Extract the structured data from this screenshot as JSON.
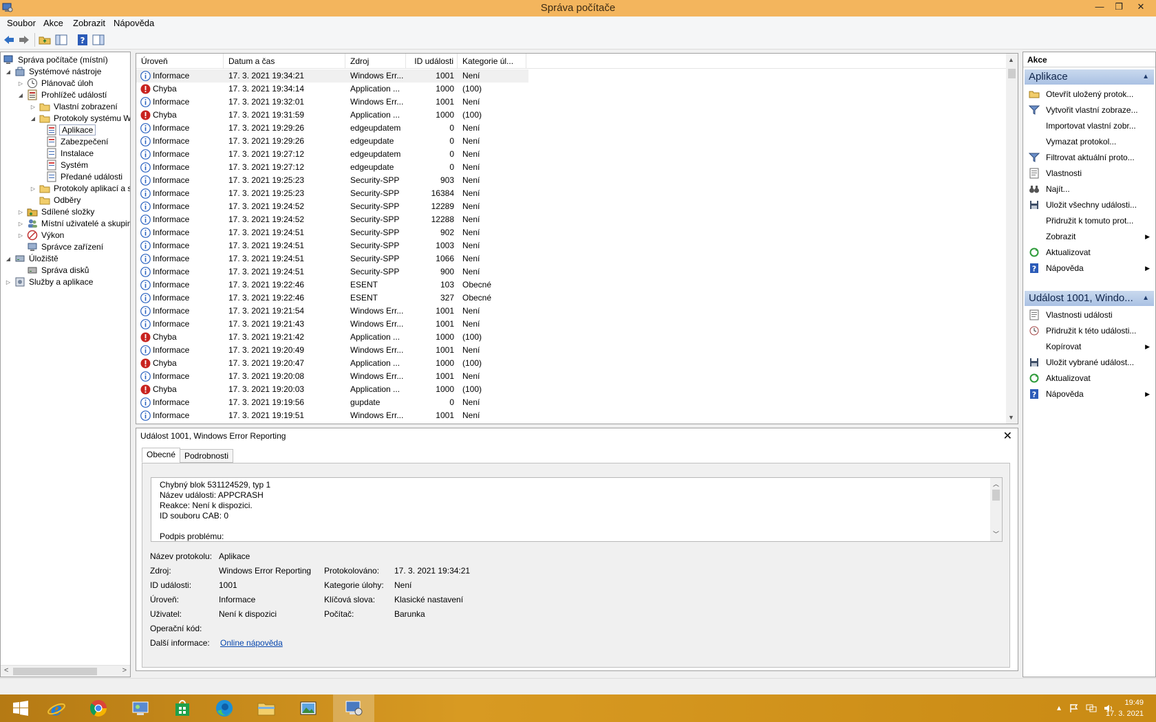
{
  "window": {
    "title": "Správa počítače",
    "minimize": "—",
    "restore": "❐",
    "close": "✕"
  },
  "menu": [
    "Soubor",
    "Akce",
    "Zobrazit",
    "Nápověda"
  ],
  "toolbar": {
    "icons": [
      "back-icon",
      "forward-icon",
      "up-folder-icon",
      "show-hide-tree-icon",
      "help-icon",
      "show-hide-action-pane-icon"
    ]
  },
  "tree": {
    "items": [
      {
        "label": "Správa počítače (místní)",
        "icon": "computer-management-icon",
        "expander": ""
      },
      {
        "label": "Systémové nástroje",
        "icon": "tools-icon",
        "expander": "◢"
      },
      {
        "label": "Plánovač úloh",
        "icon": "clock-icon",
        "expander": "▷"
      },
      {
        "label": "Prohlížeč událostí",
        "icon": "event-viewer-icon",
        "expander": "◢"
      },
      {
        "label": "Vlastní zobrazení",
        "icon": "folder-icon",
        "expander": "▷"
      },
      {
        "label": "Protokoly systému Windows",
        "icon": "folder-icon",
        "expander": "◢"
      },
      {
        "label": "Aplikace",
        "icon": "log-icon",
        "expander": ""
      },
      {
        "label": "Zabezpečení",
        "icon": "log-icon",
        "expander": ""
      },
      {
        "label": "Instalace",
        "icon": "log-icon",
        "expander": ""
      },
      {
        "label": "Systém",
        "icon": "log-icon",
        "expander": ""
      },
      {
        "label": "Předané události",
        "icon": "log-icon",
        "expander": ""
      },
      {
        "label": "Protokoly aplikací a služeb",
        "icon": "folder-icon",
        "expander": "▷"
      },
      {
        "label": "Odběry",
        "icon": "subscriptions-icon",
        "expander": ""
      },
      {
        "label": "Sdílené složky",
        "icon": "shared-folder-icon",
        "expander": "▷"
      },
      {
        "label": "Místní uživatelé a skupiny",
        "icon": "users-icon",
        "expander": "▷"
      },
      {
        "label": "Výkon",
        "icon": "performance-icon",
        "expander": "▷"
      },
      {
        "label": "Správce zařízení",
        "icon": "device-manager-icon",
        "expander": ""
      },
      {
        "label": "Úložiště",
        "icon": "storage-icon",
        "expander": "◢"
      },
      {
        "label": "Správa disků",
        "icon": "disk-icon",
        "expander": ""
      },
      {
        "label": "Služby a aplikace",
        "icon": "services-icon",
        "expander": "▷"
      }
    ]
  },
  "events": {
    "columns": [
      "Úroveň",
      "Datum a čas",
      "Zdroj",
      "ID události",
      "Kategorie úl..."
    ],
    "rows": [
      {
        "level": "Informace",
        "type": "info",
        "datetime": "17. 3. 2021 19:34:21",
        "source": "Windows Err...",
        "id": "1001",
        "category": "Není"
      },
      {
        "level": "Chyba",
        "type": "error",
        "datetime": "17. 3. 2021 19:34:14",
        "source": "Application ...",
        "id": "1000",
        "category": "(100)"
      },
      {
        "level": "Informace",
        "type": "info",
        "datetime": "17. 3. 2021 19:32:01",
        "source": "Windows Err...",
        "id": "1001",
        "category": "Není"
      },
      {
        "level": "Chyba",
        "type": "error",
        "datetime": "17. 3. 2021 19:31:59",
        "source": "Application ...",
        "id": "1000",
        "category": "(100)"
      },
      {
        "level": "Informace",
        "type": "info",
        "datetime": "17. 3. 2021 19:29:26",
        "source": "edgeupdatem",
        "id": "0",
        "category": "Není"
      },
      {
        "level": "Informace",
        "type": "info",
        "datetime": "17. 3. 2021 19:29:26",
        "source": "edgeupdate",
        "id": "0",
        "category": "Není"
      },
      {
        "level": "Informace",
        "type": "info",
        "datetime": "17. 3. 2021 19:27:12",
        "source": "edgeupdatem",
        "id": "0",
        "category": "Není"
      },
      {
        "level": "Informace",
        "type": "info",
        "datetime": "17. 3. 2021 19:27:12",
        "source": "edgeupdate",
        "id": "0",
        "category": "Není"
      },
      {
        "level": "Informace",
        "type": "info",
        "datetime": "17. 3. 2021 19:25:23",
        "source": "Security-SPP",
        "id": "903",
        "category": "Není"
      },
      {
        "level": "Informace",
        "type": "info",
        "datetime": "17. 3. 2021 19:25:23",
        "source": "Security-SPP",
        "id": "16384",
        "category": "Není"
      },
      {
        "level": "Informace",
        "type": "info",
        "datetime": "17. 3. 2021 19:24:52",
        "source": "Security-SPP",
        "id": "12289",
        "category": "Není"
      },
      {
        "level": "Informace",
        "type": "info",
        "datetime": "17. 3. 2021 19:24:52",
        "source": "Security-SPP",
        "id": "12288",
        "category": "Není"
      },
      {
        "level": "Informace",
        "type": "info",
        "datetime": "17. 3. 2021 19:24:51",
        "source": "Security-SPP",
        "id": "902",
        "category": "Není"
      },
      {
        "level": "Informace",
        "type": "info",
        "datetime": "17. 3. 2021 19:24:51",
        "source": "Security-SPP",
        "id": "1003",
        "category": "Není"
      },
      {
        "level": "Informace",
        "type": "info",
        "datetime": "17. 3. 2021 19:24:51",
        "source": "Security-SPP",
        "id": "1066",
        "category": "Není"
      },
      {
        "level": "Informace",
        "type": "info",
        "datetime": "17. 3. 2021 19:24:51",
        "source": "Security-SPP",
        "id": "900",
        "category": "Není"
      },
      {
        "level": "Informace",
        "type": "info",
        "datetime": "17. 3. 2021 19:22:46",
        "source": "ESENT",
        "id": "103",
        "category": "Obecné"
      },
      {
        "level": "Informace",
        "type": "info",
        "datetime": "17. 3. 2021 19:22:46",
        "source": "ESENT",
        "id": "327",
        "category": "Obecné"
      },
      {
        "level": "Informace",
        "type": "info",
        "datetime": "17. 3. 2021 19:21:54",
        "source": "Windows Err...",
        "id": "1001",
        "category": "Není"
      },
      {
        "level": "Informace",
        "type": "info",
        "datetime": "17. 3. 2021 19:21:43",
        "source": "Windows Err...",
        "id": "1001",
        "category": "Není"
      },
      {
        "level": "Chyba",
        "type": "error",
        "datetime": "17. 3. 2021 19:21:42",
        "source": "Application ...",
        "id": "1000",
        "category": "(100)"
      },
      {
        "level": "Informace",
        "type": "info",
        "datetime": "17. 3. 2021 19:20:49",
        "source": "Windows Err...",
        "id": "1001",
        "category": "Není"
      },
      {
        "level": "Chyba",
        "type": "error",
        "datetime": "17. 3. 2021 19:20:47",
        "source": "Application ...",
        "id": "1000",
        "category": "(100)"
      },
      {
        "level": "Informace",
        "type": "info",
        "datetime": "17. 3. 2021 19:20:08",
        "source": "Windows Err...",
        "id": "1001",
        "category": "Není"
      },
      {
        "level": "Chyba",
        "type": "error",
        "datetime": "17. 3. 2021 19:20:03",
        "source": "Application ...",
        "id": "1000",
        "category": "(100)"
      },
      {
        "level": "Informace",
        "type": "info",
        "datetime": "17. 3. 2021 19:19:56",
        "source": "gupdate",
        "id": "0",
        "category": "Není"
      },
      {
        "level": "Informace",
        "type": "info",
        "datetime": "17. 3. 2021 19:19:51",
        "source": "Windows Err...",
        "id": "1001",
        "category": "Není"
      }
    ]
  },
  "detail": {
    "title": "Událost 1001, Windows Error Reporting",
    "close": "✕",
    "tabs": [
      "Obecné",
      "Podrobnosti"
    ],
    "description": [
      "Chybný blok 531124529, typ 1",
      "Název události: APPCRASH",
      "Reakce: Není k dispozici.",
      "ID souboru CAB: 0",
      "",
      "Podpis problému:"
    ],
    "props": {
      "log_name_label": "Název protokolu:",
      "log_name": "Aplikace",
      "source_label": "Zdroj:",
      "source": "Windows Error Reporting",
      "logged_label": "Protokolováno:",
      "logged": "17. 3. 2021 19:34:21",
      "event_id_label": "ID události:",
      "event_id": "1001",
      "task_label": "Kategorie úlohy:",
      "task": "Není",
      "level_label": "Úroveň:",
      "level": "Informace",
      "keywords_label": "Klíčová slova:",
      "keywords": "Klasické nastavení",
      "user_label": "Uživatel:",
      "user": "Není k dispozici",
      "computer_label": "Počítač:",
      "computer": "Barunka",
      "opcode_label": "Operační kód:",
      "opcode": "",
      "more_label": "Další informace:",
      "more_link": "Online nápověda"
    }
  },
  "actions": {
    "header": "Akce",
    "section1": "Aplikace",
    "items1": [
      {
        "label": "Otevřít uložený protok...",
        "icon": "open-folder-icon",
        "submenu": false
      },
      {
        "label": "Vytvořit vlastní zobraze...",
        "icon": "filter-icon",
        "submenu": false
      },
      {
        "label": "Importovat vlastní zobr...",
        "icon": "",
        "submenu": false
      },
      {
        "label": "Vymazat protokol...",
        "icon": "",
        "submenu": false
      },
      {
        "label": "Filtrovat aktuální proto...",
        "icon": "filter-icon",
        "submenu": false
      },
      {
        "label": "Vlastnosti",
        "icon": "properties-icon",
        "submenu": false
      },
      {
        "label": "Najít...",
        "icon": "binoculars-icon",
        "submenu": false
      },
      {
        "label": "Uložit všechny události...",
        "icon": "save-icon",
        "submenu": false
      },
      {
        "label": "Přidružit k tomuto prot...",
        "icon": "",
        "submenu": false
      },
      {
        "label": "Zobrazit",
        "icon": "",
        "submenu": true
      },
      {
        "label": "Aktualizovat",
        "icon": "refresh-icon",
        "submenu": false
      },
      {
        "label": "Nápověda",
        "icon": "help-icon",
        "submenu": true
      }
    ],
    "section2": "Událost 1001, Windo...",
    "items2": [
      {
        "label": "Vlastnosti události",
        "icon": "properties-icon",
        "submenu": false
      },
      {
        "label": "Přidružit k této události...",
        "icon": "task-icon",
        "submenu": false
      },
      {
        "label": "Kopírovat",
        "icon": "",
        "submenu": true
      },
      {
        "label": "Uložit vybrané událost...",
        "icon": "save-icon",
        "submenu": false
      },
      {
        "label": "Aktualizovat",
        "icon": "refresh-icon",
        "submenu": false
      },
      {
        "label": "Nápověda",
        "icon": "help-icon",
        "submenu": true
      }
    ]
  },
  "taskbar": {
    "apps": [
      "start-icon",
      "internet-explorer-icon",
      "chrome-icon",
      "control-panel-icon",
      "store-icon",
      "edge-icon",
      "file-explorer-icon",
      "photo-viewer-icon",
      "computer-management-icon"
    ],
    "time": "19:49",
    "date": "17. 3. 2021"
  }
}
